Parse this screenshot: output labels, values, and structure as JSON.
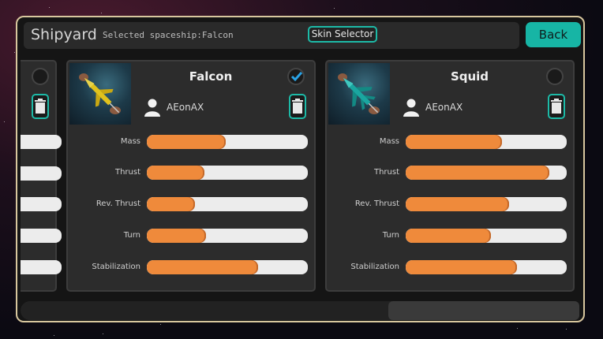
{
  "header": {
    "title": "Shipyard",
    "subtitle": "Selected spaceship:Falcon",
    "skin_selector_label": "Skin Selector",
    "back_label": "Back"
  },
  "colors": {
    "accent": "#1dbaa7",
    "bar_fill": "#ef8a3b",
    "bar_track": "#ececec",
    "frame_border": "#d8c79e",
    "checkmark": "#2aa3e6"
  },
  "stat_labels": [
    "Mass",
    "Thrust",
    "Rev. Thrust",
    "Turn",
    "Stabilization"
  ],
  "ships": [
    {
      "name": "Falcon",
      "author": "AEonAX",
      "selected": true,
      "ship_color": "#e0c21d",
      "stats": {
        "mass": 0.49,
        "thrust": 0.36,
        "rev_thrust": 0.3,
        "turn": 0.37,
        "stabilization": 0.69
      }
    },
    {
      "name": "Squid",
      "author": "AEonAX",
      "selected": false,
      "ship_color": "#1aa6a0",
      "stats": {
        "mass": 0.6,
        "thrust": 0.89,
        "rev_thrust": 0.64,
        "turn": 0.53,
        "stabilization": 0.69
      }
    }
  ],
  "icons": {
    "check": "checkmark-icon",
    "author": "person-icon",
    "delete": "trash-icon"
  }
}
